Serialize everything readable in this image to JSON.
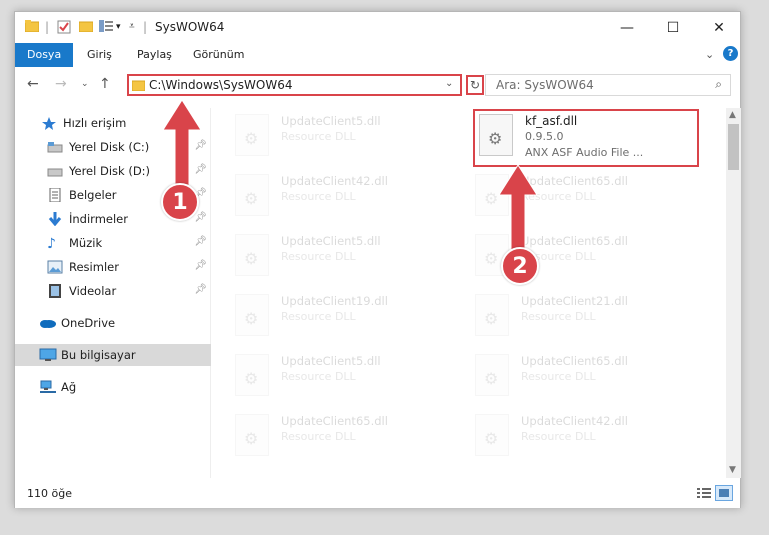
{
  "window": {
    "title": "SysWOW64",
    "controls": [
      "minimize",
      "maximize",
      "close"
    ]
  },
  "ribbon": {
    "tabs": [
      "Dosya",
      "Giriş",
      "Paylaş",
      "Görünüm"
    ],
    "active_tab": "Dosya"
  },
  "address": {
    "path": "C:\\Windows\\SysWOW64"
  },
  "search": {
    "placeholder": "Ara: SysWOW64"
  },
  "sidebar": {
    "items": [
      {
        "label": "Hızlı erişim",
        "icon": "star-icon"
      },
      {
        "label": "Yerel Disk (C:)",
        "icon": "drive-icon",
        "pinned": true
      },
      {
        "label": "Yerel Disk (D:)",
        "icon": "drive-icon",
        "pinned": true
      },
      {
        "label": "Belgeler",
        "icon": "document-icon",
        "pinned": true
      },
      {
        "label": "İndirmeler",
        "icon": "download-icon",
        "pinned": true
      },
      {
        "label": "Müzik",
        "icon": "music-icon",
        "pinned": true
      },
      {
        "label": "Resimler",
        "icon": "pictures-icon",
        "pinned": true
      },
      {
        "label": "Videolar",
        "icon": "video-icon",
        "pinned": true
      },
      {
        "label": "OneDrive",
        "icon": "cloud-icon"
      },
      {
        "label": "Bu bilgisayar",
        "icon": "computer-icon",
        "selected": true
      },
      {
        "label": "Ağ",
        "icon": "network-icon"
      }
    ]
  },
  "files": {
    "target": {
      "name": "kf_asf.dll",
      "version": "0.9.5.0",
      "description": "ANX ASF Audio File ..."
    },
    "left_column": [
      {
        "name": "UpdateClient5.dll",
        "type": "Resource DLL"
      },
      {
        "name": "UpdateClient42.dll",
        "type": "Resource DLL"
      },
      {
        "name": "UpdateClient5.dll",
        "type": "Resource DLL"
      },
      {
        "name": "UpdateClient19.dll",
        "type": "Resource DLL"
      },
      {
        "name": "UpdateClient5.dll",
        "type": "Resource DLL"
      },
      {
        "name": "UpdateClient65.dll",
        "type": "Resource DLL"
      }
    ],
    "right_column": [
      {
        "name": "UpdateClient65.dll",
        "type": "Resource DLL"
      },
      {
        "name": "UpdateClient65.dll",
        "type": "Resource DLL"
      },
      {
        "name": "UpdateClient21.dll",
        "type": "Resource DLL"
      },
      {
        "name": "UpdateClient65.dll",
        "type": "Resource DLL"
      },
      {
        "name": "UpdateClient42.dll",
        "type": "Resource DLL"
      }
    ]
  },
  "status": {
    "item_count": "110 öğe"
  },
  "callouts": {
    "step1": "1",
    "step2": "2",
    "color": "#d9444a"
  }
}
